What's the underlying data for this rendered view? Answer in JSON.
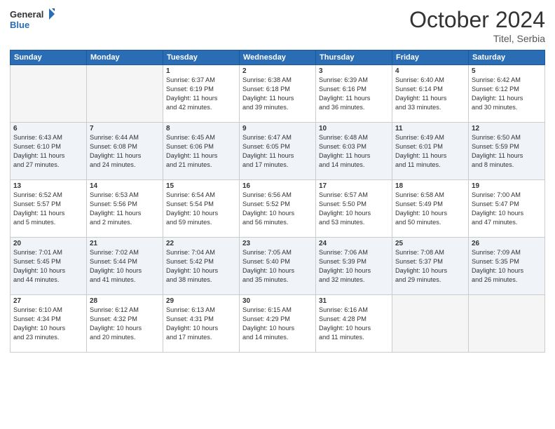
{
  "header": {
    "logo_general": "General",
    "logo_blue": "Blue",
    "month": "October 2024",
    "location": "Titel, Serbia"
  },
  "weekdays": [
    "Sunday",
    "Monday",
    "Tuesday",
    "Wednesday",
    "Thursday",
    "Friday",
    "Saturday"
  ],
  "weeks": [
    [
      {
        "num": "",
        "lines": []
      },
      {
        "num": "",
        "lines": []
      },
      {
        "num": "1",
        "lines": [
          "Sunrise: 6:37 AM",
          "Sunset: 6:19 PM",
          "Daylight: 11 hours",
          "and 42 minutes."
        ]
      },
      {
        "num": "2",
        "lines": [
          "Sunrise: 6:38 AM",
          "Sunset: 6:18 PM",
          "Daylight: 11 hours",
          "and 39 minutes."
        ]
      },
      {
        "num": "3",
        "lines": [
          "Sunrise: 6:39 AM",
          "Sunset: 6:16 PM",
          "Daylight: 11 hours",
          "and 36 minutes."
        ]
      },
      {
        "num": "4",
        "lines": [
          "Sunrise: 6:40 AM",
          "Sunset: 6:14 PM",
          "Daylight: 11 hours",
          "and 33 minutes."
        ]
      },
      {
        "num": "5",
        "lines": [
          "Sunrise: 6:42 AM",
          "Sunset: 6:12 PM",
          "Daylight: 11 hours",
          "and 30 minutes."
        ]
      }
    ],
    [
      {
        "num": "6",
        "lines": [
          "Sunrise: 6:43 AM",
          "Sunset: 6:10 PM",
          "Daylight: 11 hours",
          "and 27 minutes."
        ]
      },
      {
        "num": "7",
        "lines": [
          "Sunrise: 6:44 AM",
          "Sunset: 6:08 PM",
          "Daylight: 11 hours",
          "and 24 minutes."
        ]
      },
      {
        "num": "8",
        "lines": [
          "Sunrise: 6:45 AM",
          "Sunset: 6:06 PM",
          "Daylight: 11 hours",
          "and 21 minutes."
        ]
      },
      {
        "num": "9",
        "lines": [
          "Sunrise: 6:47 AM",
          "Sunset: 6:05 PM",
          "Daylight: 11 hours",
          "and 17 minutes."
        ]
      },
      {
        "num": "10",
        "lines": [
          "Sunrise: 6:48 AM",
          "Sunset: 6:03 PM",
          "Daylight: 11 hours",
          "and 14 minutes."
        ]
      },
      {
        "num": "11",
        "lines": [
          "Sunrise: 6:49 AM",
          "Sunset: 6:01 PM",
          "Daylight: 11 hours",
          "and 11 minutes."
        ]
      },
      {
        "num": "12",
        "lines": [
          "Sunrise: 6:50 AM",
          "Sunset: 5:59 PM",
          "Daylight: 11 hours",
          "and 8 minutes."
        ]
      }
    ],
    [
      {
        "num": "13",
        "lines": [
          "Sunrise: 6:52 AM",
          "Sunset: 5:57 PM",
          "Daylight: 11 hours",
          "and 5 minutes."
        ]
      },
      {
        "num": "14",
        "lines": [
          "Sunrise: 6:53 AM",
          "Sunset: 5:56 PM",
          "Daylight: 11 hours",
          "and 2 minutes."
        ]
      },
      {
        "num": "15",
        "lines": [
          "Sunrise: 6:54 AM",
          "Sunset: 5:54 PM",
          "Daylight: 10 hours",
          "and 59 minutes."
        ]
      },
      {
        "num": "16",
        "lines": [
          "Sunrise: 6:56 AM",
          "Sunset: 5:52 PM",
          "Daylight: 10 hours",
          "and 56 minutes."
        ]
      },
      {
        "num": "17",
        "lines": [
          "Sunrise: 6:57 AM",
          "Sunset: 5:50 PM",
          "Daylight: 10 hours",
          "and 53 minutes."
        ]
      },
      {
        "num": "18",
        "lines": [
          "Sunrise: 6:58 AM",
          "Sunset: 5:49 PM",
          "Daylight: 10 hours",
          "and 50 minutes."
        ]
      },
      {
        "num": "19",
        "lines": [
          "Sunrise: 7:00 AM",
          "Sunset: 5:47 PM",
          "Daylight: 10 hours",
          "and 47 minutes."
        ]
      }
    ],
    [
      {
        "num": "20",
        "lines": [
          "Sunrise: 7:01 AM",
          "Sunset: 5:45 PM",
          "Daylight: 10 hours",
          "and 44 minutes."
        ]
      },
      {
        "num": "21",
        "lines": [
          "Sunrise: 7:02 AM",
          "Sunset: 5:44 PM",
          "Daylight: 10 hours",
          "and 41 minutes."
        ]
      },
      {
        "num": "22",
        "lines": [
          "Sunrise: 7:04 AM",
          "Sunset: 5:42 PM",
          "Daylight: 10 hours",
          "and 38 minutes."
        ]
      },
      {
        "num": "23",
        "lines": [
          "Sunrise: 7:05 AM",
          "Sunset: 5:40 PM",
          "Daylight: 10 hours",
          "and 35 minutes."
        ]
      },
      {
        "num": "24",
        "lines": [
          "Sunrise: 7:06 AM",
          "Sunset: 5:39 PM",
          "Daylight: 10 hours",
          "and 32 minutes."
        ]
      },
      {
        "num": "25",
        "lines": [
          "Sunrise: 7:08 AM",
          "Sunset: 5:37 PM",
          "Daylight: 10 hours",
          "and 29 minutes."
        ]
      },
      {
        "num": "26",
        "lines": [
          "Sunrise: 7:09 AM",
          "Sunset: 5:35 PM",
          "Daylight: 10 hours",
          "and 26 minutes."
        ]
      }
    ],
    [
      {
        "num": "27",
        "lines": [
          "Sunrise: 6:10 AM",
          "Sunset: 4:34 PM",
          "Daylight: 10 hours",
          "and 23 minutes."
        ]
      },
      {
        "num": "28",
        "lines": [
          "Sunrise: 6:12 AM",
          "Sunset: 4:32 PM",
          "Daylight: 10 hours",
          "and 20 minutes."
        ]
      },
      {
        "num": "29",
        "lines": [
          "Sunrise: 6:13 AM",
          "Sunset: 4:31 PM",
          "Daylight: 10 hours",
          "and 17 minutes."
        ]
      },
      {
        "num": "30",
        "lines": [
          "Sunrise: 6:15 AM",
          "Sunset: 4:29 PM",
          "Daylight: 10 hours",
          "and 14 minutes."
        ]
      },
      {
        "num": "31",
        "lines": [
          "Sunrise: 6:16 AM",
          "Sunset: 4:28 PM",
          "Daylight: 10 hours",
          "and 11 minutes."
        ]
      },
      {
        "num": "",
        "lines": []
      },
      {
        "num": "",
        "lines": []
      }
    ]
  ]
}
